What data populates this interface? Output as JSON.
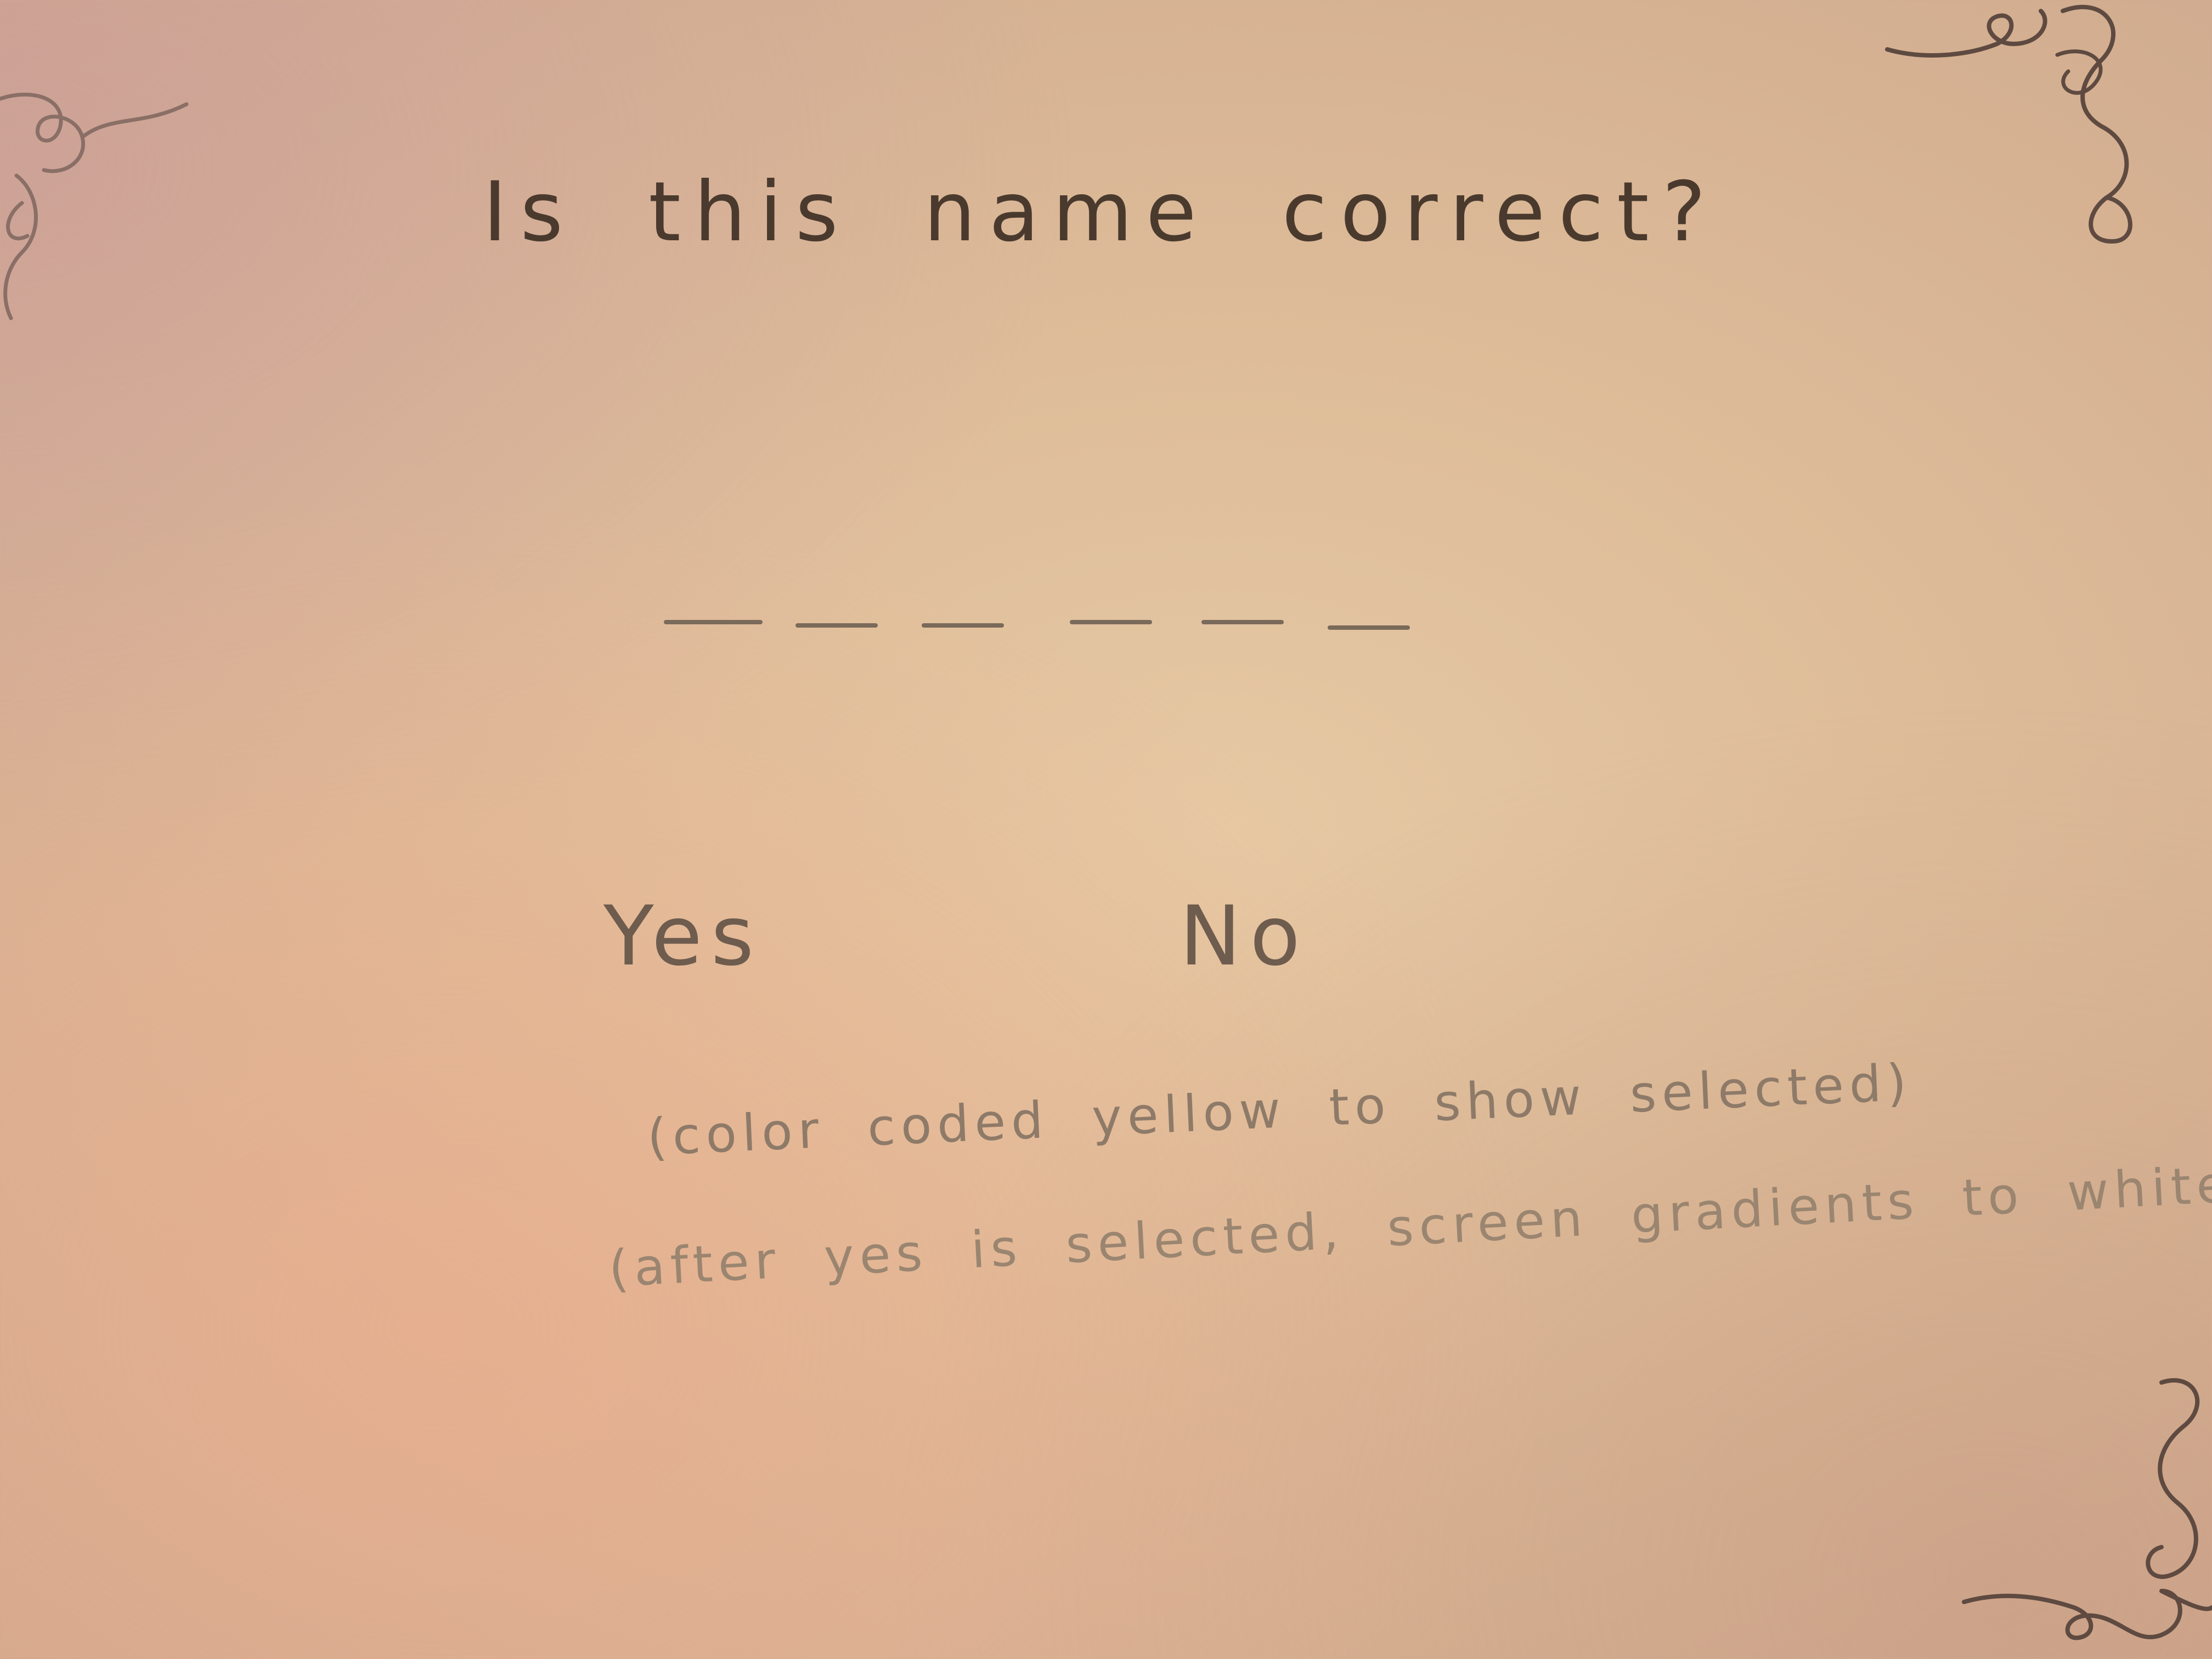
{
  "prompt": {
    "question": "Is this name correct?"
  },
  "name_field": {
    "blank_count": 6
  },
  "choices": {
    "yes_label": "Yes",
    "no_label": "No"
  },
  "notes": {
    "line1": "(color coded yellow to show selected)",
    "line2": "(after yes is selected, screen gradients to white.)"
  },
  "decorations": {
    "corner_icon": "treble-clef-flourish-icon"
  },
  "colors": {
    "paper": "#e6c9a4",
    "ink": "#4a3a2e",
    "ink_light": "#8e7a68"
  }
}
